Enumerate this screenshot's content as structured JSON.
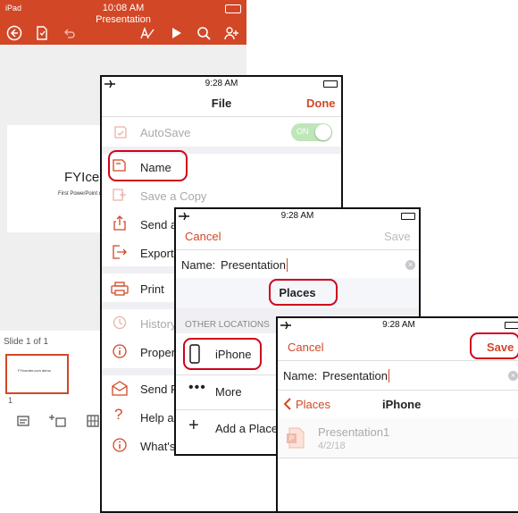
{
  "powerpoint": {
    "time": "10:08 AM",
    "title": "Presentation",
    "slide_title": "FYIcen",
    "slide_subtitle": "First PowerPoint d",
    "slide_count": "Slide 1 of 1",
    "thumb_text": "FYIcenter.com demo",
    "thumb_number": "1"
  },
  "file_panel": {
    "time": "9:28 AM",
    "title": "File",
    "done": "Done",
    "autosave": "AutoSave",
    "toggle": "ON",
    "items": {
      "name": "Name",
      "save_copy": "Save a Copy",
      "send": "Send a",
      "export": "Export",
      "print": "Print",
      "history": "History",
      "properties": "Proper",
      "send_feedback": "Send F",
      "help": "Help a",
      "whats_new": "What's"
    }
  },
  "saveas_panel": {
    "time": "9:28 AM",
    "cancel": "Cancel",
    "save": "Save",
    "name_label": "Name:",
    "name_value": "Presentation",
    "places": "Places",
    "other_locations": "OTHER LOCATIONS",
    "iphone": "iPhone",
    "more": "More",
    "add_place": "Add a Place"
  },
  "iphone_panel": {
    "time": "9:28 AM",
    "cancel": "Cancel",
    "save": "Save",
    "name_label": "Name:",
    "name_value": "Presentation",
    "back": "Places",
    "title": "iPhone",
    "file_name": "Presentation1",
    "file_date": "4/2/18"
  },
  "colors": {
    "accent": "#d24726",
    "highlight": "#d0021b",
    "toggle": "#4cd964"
  }
}
